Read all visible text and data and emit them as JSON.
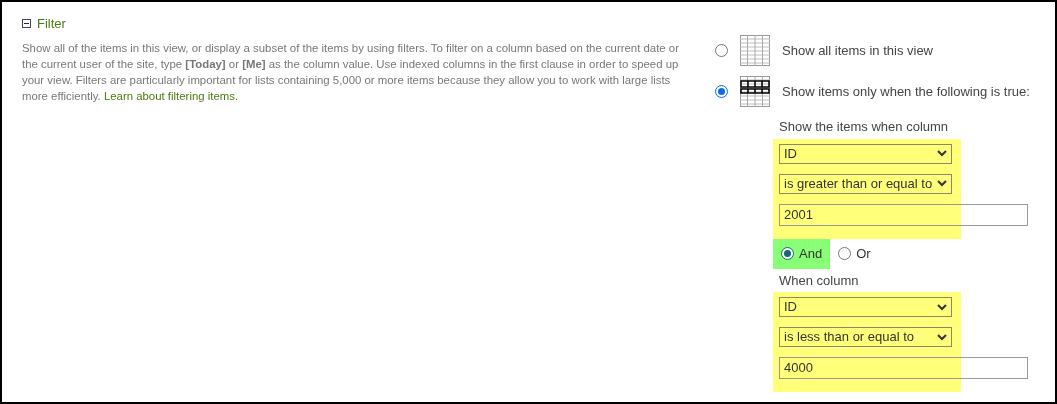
{
  "section": {
    "title": "Filter",
    "expanded": true,
    "description": "Show all of the items in this view, or display a subset of the items by using filters. To filter on a column based on the current date or the current user of the site, type **[Today]** or **[Me]** as the column value. Use indexed columns in the first clause in order to speed up your view. Filters are particularly important for lists containing 5,000 or more items because they allow you to work with large lists more efficiently.",
    "link": "Learn about filtering items."
  },
  "options": [
    {
      "kind": "all",
      "label": "Show all items in this view",
      "selected": false
    },
    {
      "kind": "filtered",
      "label": "Show items only when the following is true:",
      "selected": true
    }
  ],
  "clauses": [
    {
      "heading": "Show the items when column",
      "column": "ID",
      "operator": "is greater than or equal to",
      "value": "2001",
      "highlighted": true
    },
    {
      "heading": "When column",
      "column": "ID",
      "operator": "is less than or equal to",
      "value": "4000",
      "highlighted": true
    }
  ],
  "connector": [
    {
      "label": "And",
      "selected": true,
      "highlighted": true
    },
    {
      "label": "Or",
      "selected": false,
      "highlighted": false
    }
  ]
}
